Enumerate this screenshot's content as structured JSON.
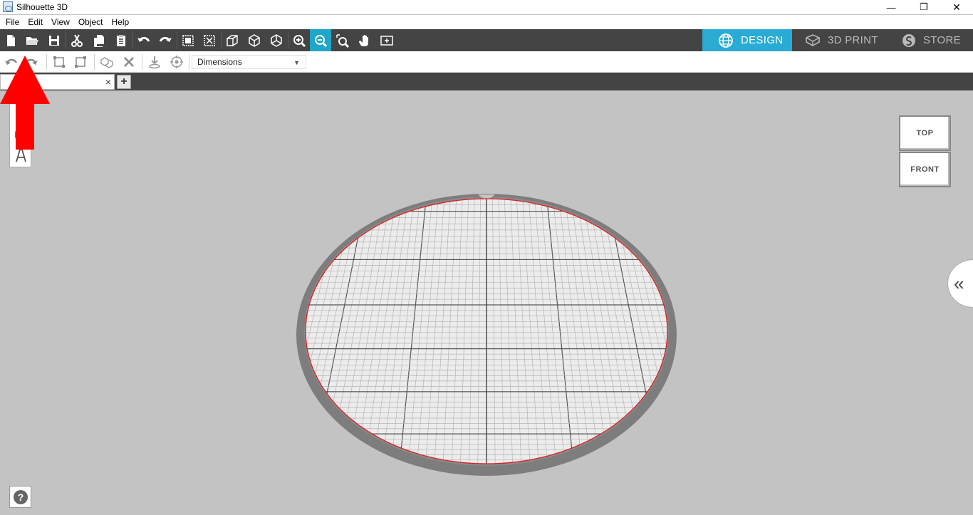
{
  "window": {
    "title": "Silhouette 3D",
    "minimize": "—",
    "maximize": "❐",
    "close": "✕"
  },
  "menu": [
    "File",
    "Edit",
    "View",
    "Object",
    "Help"
  ],
  "toolbar": {
    "tools": [
      "new",
      "open",
      "save",
      "cut",
      "copy",
      "paste",
      "undo",
      "redo",
      "group",
      "ungroup",
      "3d-view",
      "box-view",
      "iso-view",
      "zoom-in",
      "zoom-out",
      "zoom-fit",
      "pan",
      "fit-page"
    ],
    "active_tool": "zoom-out"
  },
  "modes": {
    "design": "DESIGN",
    "print": "3D PRINT",
    "store": "STORE",
    "active": "design"
  },
  "secondary_toolbar": {
    "dimensions_label": "Dimensions",
    "dimensions_arrow": "▼"
  },
  "document": {
    "tab_name": "",
    "close": "×",
    "add": "+"
  },
  "view_cube": {
    "top": "TOP",
    "front": "FRONT"
  },
  "panel_toggle": "«",
  "help": "?",
  "colors": {
    "toolbar_bg": "#444444",
    "accent": "#29abd4",
    "canvas_bg": "#c3c3c3",
    "annotation_arrow": "#ff0000"
  }
}
